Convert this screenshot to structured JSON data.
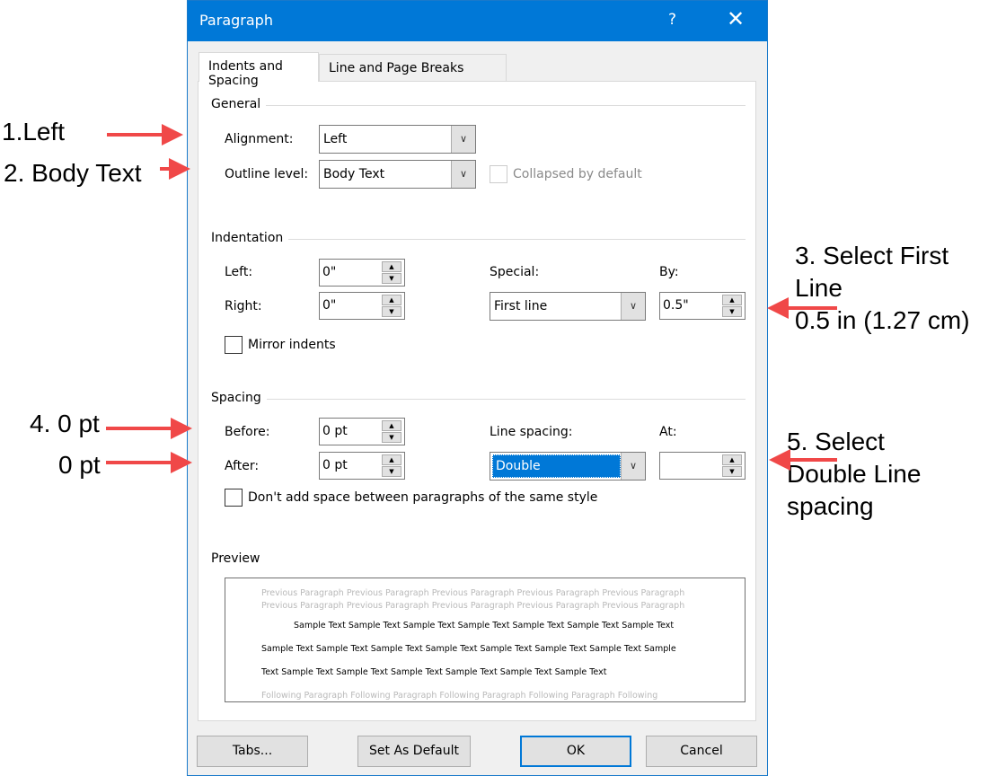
{
  "dialog": {
    "title": "Paragraph",
    "help": "?",
    "close": "✕",
    "tabs": [
      {
        "label": "Indents and Spacing",
        "active": true
      },
      {
        "label": "Line and Page Breaks",
        "active": false
      }
    ],
    "general": {
      "heading": "General",
      "alignment_label": "Alignment:",
      "alignment_value": "Left",
      "outline_label": "Outline level:",
      "outline_value": "Body Text",
      "collapsed_label": "Collapsed by default",
      "collapsed_checked": false
    },
    "indentation": {
      "heading": "Indentation",
      "left_label": "Left:",
      "left_value": "0\"",
      "right_label": "Right:",
      "right_value": "0\"",
      "special_label": "Special:",
      "special_value": "First line",
      "by_label": "By:",
      "by_value": "0.5\"",
      "mirror_label": "Mirror indents",
      "mirror_checked": false
    },
    "spacing": {
      "heading": "Spacing",
      "before_label": "Before:",
      "before_value": "0 pt",
      "after_label": "After:",
      "after_value": "0 pt",
      "line_spacing_label": "Line spacing:",
      "line_spacing_value": "Double",
      "at_label": "At:",
      "at_value": "",
      "dont_add_label": "Don't add space between paragraphs of the same style",
      "dont_add_checked": false
    },
    "preview": {
      "heading": "Preview",
      "previous": [
        "Previous Paragraph Previous Paragraph Previous Paragraph Previous Paragraph Previous Paragraph",
        "Previous Paragraph Previous Paragraph Previous Paragraph Previous Paragraph Previous Paragraph"
      ],
      "sample": [
        "Sample Text Sample Text Sample Text Sample Text Sample Text Sample Text Sample Text",
        "Sample Text Sample Text Sample Text Sample Text Sample Text Sample Text Sample Text Sample",
        "Text Sample Text Sample Text Sample Text Sample Text Sample Text Sample Text"
      ],
      "following": "Following Paragraph Following Paragraph Following Paragraph Following Paragraph Following"
    },
    "buttons": {
      "tabs": "Tabs...",
      "set_default": "Set As Default",
      "ok": "OK",
      "cancel": "Cancel"
    },
    "colors": {
      "titlebar": "#0078d7",
      "highlight": "#0078d7"
    }
  },
  "annotations": {
    "a1": "1.Left",
    "a2": "2. Body Text",
    "a3_line1": "3. Select First",
    "a3_line2": "Line",
    "a3_line3": "0.5 in (1.27 cm)",
    "a4": "4. 0 pt",
    "a4b": "0 pt",
    "a5_line1": "5. Select",
    "a5_line2": "Double Line",
    "a5_line3": "spacing",
    "arrow_color": "#f04848"
  }
}
